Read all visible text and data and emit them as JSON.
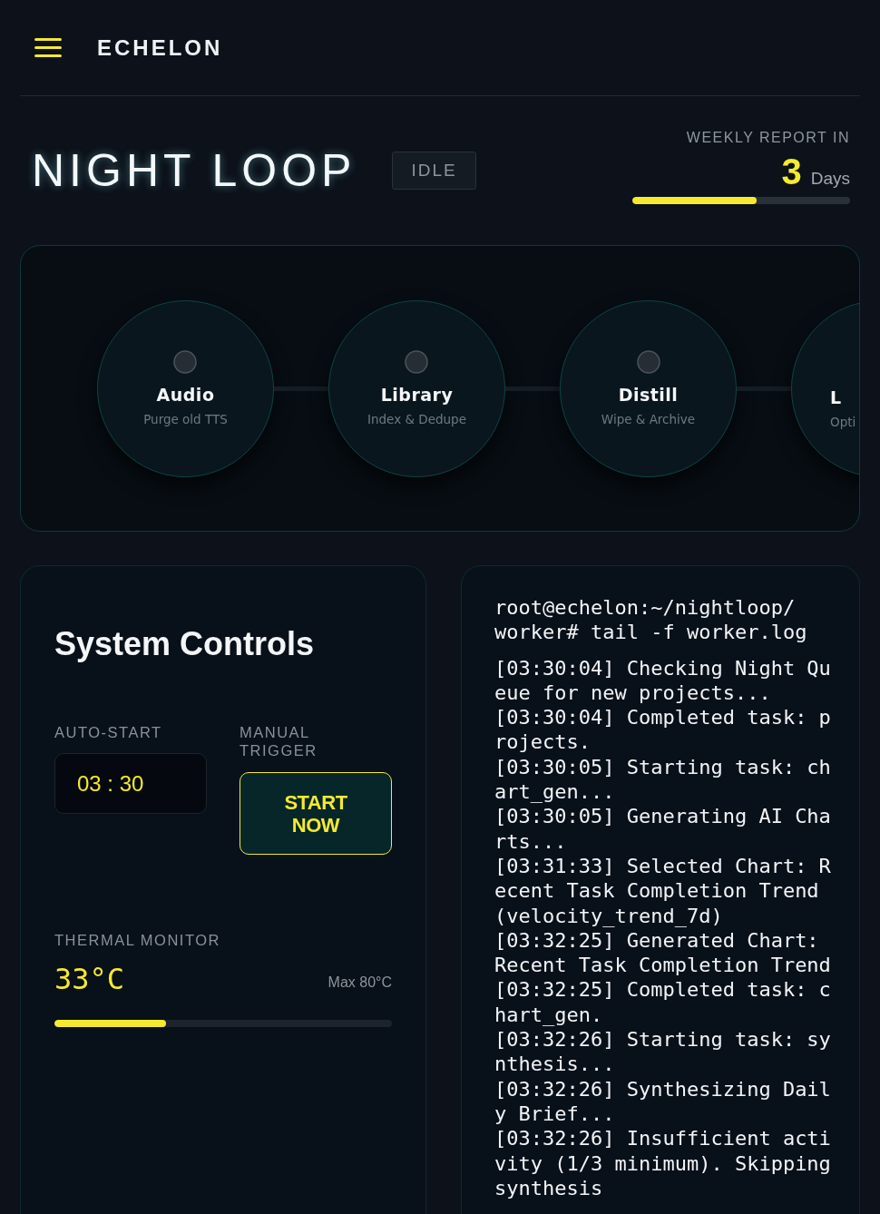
{
  "brand": "ECHELON",
  "title": "NIGHT LOOP",
  "status_badge": "IDLE",
  "weekly_report": {
    "label": "WEEKLY REPORT IN",
    "count": "3",
    "unit": "Days",
    "level": 0.57
  },
  "pipeline": [
    {
      "name": "Audio",
      "subtitle": "Purge old TTS",
      "cut_off": false
    },
    {
      "name": "Library",
      "subtitle": "Index & Dedupe",
      "cut_off": false
    },
    {
      "name": "Distill",
      "subtitle": "Wipe & Archive",
      "cut_off": false
    },
    {
      "name": "L",
      "subtitle": "Opti",
      "cut_off": true
    }
  ],
  "controls": {
    "title": "System Controls",
    "auto_start_label": "AUTO-START",
    "auto_start_time": "03 : 30",
    "manual_label": "MANUAL TRIGGER",
    "start_button": "START NOW",
    "thermal_label": "THERMAL MONITOR",
    "temperature": "33°C",
    "max": "Max 80°C",
    "level": 0.33
  },
  "terminal": {
    "prompt": "root@echelon:~/nightloop/worker# tail -f worker.log",
    "lines": [
      "[03:30:04] Checking Night Queue for new projects...",
      "[03:30:04] Completed task: projects.",
      "[03:30:05] Starting task: chart_gen...",
      "[03:30:05] Generating AI Charts...",
      "[03:31:33] Selected Chart: Recent Task Completion Trend (velocity_trend_7d)",
      "[03:32:25] Generated Chart: Recent Task Completion Trend",
      "[03:32:25] Completed task: chart_gen.",
      "[03:32:26] Starting task: synthesis...",
      "[03:32:26] Synthesizing Daily Brief...",
      "[03:32:26] Insufficient activity (1/3 minimum). Skipping synthesis"
    ]
  }
}
